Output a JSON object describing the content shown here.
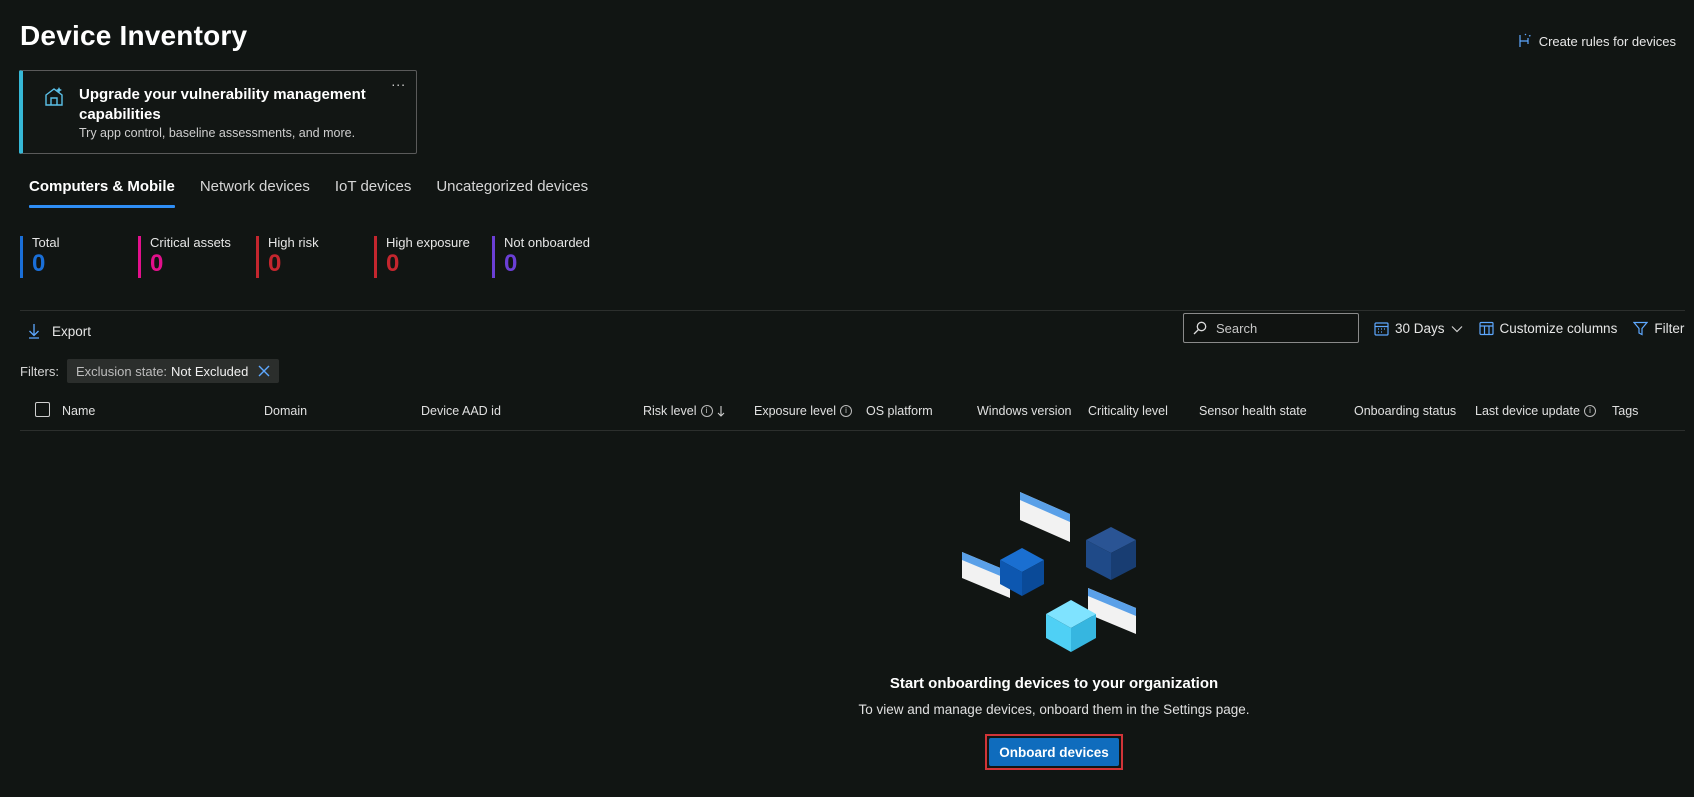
{
  "header": {
    "title": "Device Inventory",
    "create_rules_label": "Create rules for devices"
  },
  "promo": {
    "title": "Upgrade your vulnerability management capabilities",
    "subtitle": "Try app control, baseline assessments, and more.",
    "more_label": "..."
  },
  "tabs": [
    {
      "label": "Computers & Mobile",
      "active": true
    },
    {
      "label": "Network devices",
      "active": false
    },
    {
      "label": "IoT devices",
      "active": false
    },
    {
      "label": "Uncategorized devices",
      "active": false
    }
  ],
  "stats": [
    {
      "label": "Total",
      "value": "0",
      "color": "#1a6fd8"
    },
    {
      "label": "Critical assets",
      "value": "0",
      "color": "#e3108c"
    },
    {
      "label": "High risk",
      "value": "0",
      "color": "#c4262e"
    },
    {
      "label": "High exposure",
      "value": "0",
      "color": "#c4262e"
    },
    {
      "label": "Not onboarded",
      "value": "0",
      "color": "#6b3fd6"
    }
  ],
  "toolbar": {
    "export_label": "Export",
    "search_placeholder": "Search",
    "days_label": "30 Days",
    "customize_label": "Customize columns",
    "filter_label": "Filter"
  },
  "filters": {
    "label": "Filters:",
    "chip_key": "Exclusion state:",
    "chip_value": "Not Excluded"
  },
  "table": {
    "columns": [
      "Name",
      "Domain",
      "Device AAD id",
      "Risk level",
      "Exposure level",
      "OS platform",
      "Windows version",
      "Criticality level",
      "Sensor health state",
      "Onboarding status",
      "Last device update",
      "Tags"
    ]
  },
  "empty_state": {
    "title": "Start onboarding devices to your organization",
    "subtitle": "To view and manage devices, onboard them in the Settings page.",
    "button_label": "Onboard devices"
  },
  "icons": {
    "create_rules": "rules-sparkle-icon",
    "promo": "upgrade-icon",
    "export": "download-arrow-icon",
    "search": "search-icon",
    "calendar": "calendar-icon",
    "chevron": "chevron-down-icon",
    "columns": "columns-icon",
    "filter": "filter-icon",
    "close": "close-icon",
    "sort": "arrow-down-icon",
    "info": "info-icon"
  },
  "colors": {
    "accent": "#2f8ef5",
    "promo_border": "#36b8d6",
    "button": "#0f6cbd",
    "highlight_outline": "#d13438",
    "background": "#111513"
  }
}
